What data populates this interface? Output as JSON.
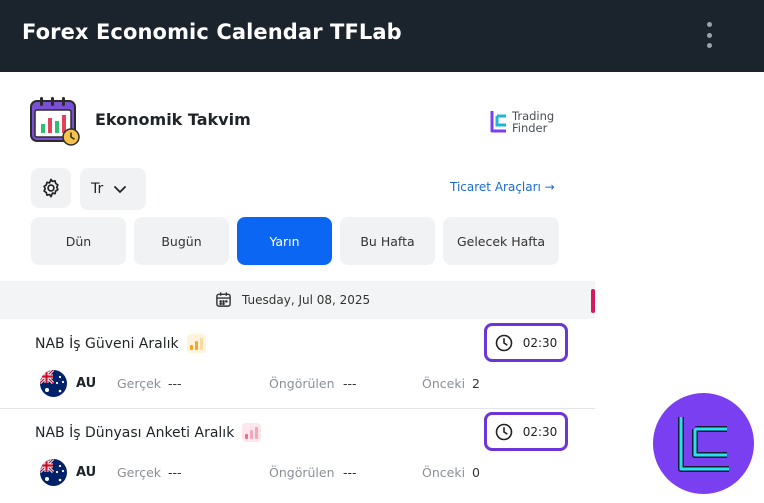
{
  "window": {
    "title": "Forex Economic Calendar TFLab"
  },
  "header": {
    "app_name": "Ekonomik Takvim",
    "brand_line1": "Trading",
    "brand_line2": "Finder"
  },
  "controls": {
    "language": "Tr",
    "tools_link": "Ticaret Araçları →"
  },
  "tabs": [
    {
      "label": "Dün",
      "active": false
    },
    {
      "label": "Bugün",
      "active": false
    },
    {
      "label": "Yarın",
      "active": true
    },
    {
      "label": "Bu Hafta",
      "active": false
    },
    {
      "label": "Gelecek Hafta",
      "active": false
    }
  ],
  "date": "Tuesday, Jul 08, 2025",
  "labels": {
    "actual": "Gerçek",
    "forecast": "Öngörülen",
    "previous": "Önceki"
  },
  "events": [
    {
      "title": "NAB İş Güveni Aralık",
      "time": "02:30",
      "country": "AU",
      "actual": "---",
      "forecast": "---",
      "previous": "2",
      "impact_color": "#f5a623",
      "impact_bg": "#fff3dc"
    },
    {
      "title": "NAB İş Dünyası Anketi Aralık",
      "time": "02:30",
      "country": "AU",
      "actual": "---",
      "forecast": "---",
      "previous": "0",
      "impact_color": "#f06a8c",
      "impact_bg": "#fde6ec"
    }
  ],
  "colors": {
    "topbar": "#1b232c",
    "active_tab": "#0b66f4",
    "time_border": "#6b35d8",
    "link": "#1a6bd1",
    "brand_circle": "#7a3ff0"
  },
  "icons": {
    "menu": "kebab-menu-icon",
    "settings": "gear-icon",
    "language_chevron": "chevron-down-icon",
    "calendar": "calendar-icon",
    "clock": "clock-icon"
  }
}
